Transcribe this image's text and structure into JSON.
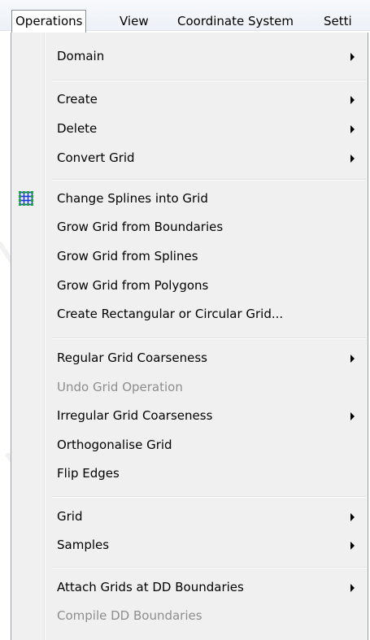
{
  "menubar": {
    "items": [
      {
        "label": "Operations"
      },
      {
        "label": "View"
      },
      {
        "label": "Coordinate System"
      },
      {
        "label": "Setti"
      }
    ]
  },
  "menu": {
    "items": [
      {
        "label": "Domain",
        "submenu": true,
        "enabled": true
      },
      {
        "label": "Create",
        "submenu": true,
        "enabled": true
      },
      {
        "label": "Delete",
        "submenu": true,
        "enabled": true
      },
      {
        "label": "Convert Grid",
        "submenu": true,
        "enabled": true
      },
      {
        "label": "Change Splines into Grid",
        "submenu": false,
        "enabled": true,
        "icon": "grid-icon"
      },
      {
        "label": "Grow Grid from Boundaries",
        "submenu": false,
        "enabled": true
      },
      {
        "label": "Grow Grid from Splines",
        "submenu": false,
        "enabled": true
      },
      {
        "label": "Grow Grid from Polygons",
        "submenu": false,
        "enabled": true
      },
      {
        "label": "Create Rectangular or Circular Grid...",
        "submenu": false,
        "enabled": true
      },
      {
        "label": "Regular Grid Coarseness",
        "submenu": true,
        "enabled": true
      },
      {
        "label": "Undo Grid Operation",
        "submenu": false,
        "enabled": false
      },
      {
        "label": "Irregular Grid Coarseness",
        "submenu": true,
        "enabled": true
      },
      {
        "label": "Orthogonalise Grid",
        "submenu": false,
        "enabled": true
      },
      {
        "label": "Flip Edges",
        "submenu": false,
        "enabled": true
      },
      {
        "label": "Grid",
        "submenu": true,
        "enabled": true
      },
      {
        "label": "Samples",
        "submenu": true,
        "enabled": true
      },
      {
        "label": "Attach Grids at DD Boundaries",
        "submenu": true,
        "enabled": true
      },
      {
        "label": "Compile DD Boundaries",
        "submenu": false,
        "enabled": false
      }
    ]
  },
  "colors": {
    "grid_icon_lines": "#1a3ad8",
    "grid_icon_nodes": "#1fa83a",
    "disabled_text": "#8d8d8d"
  }
}
